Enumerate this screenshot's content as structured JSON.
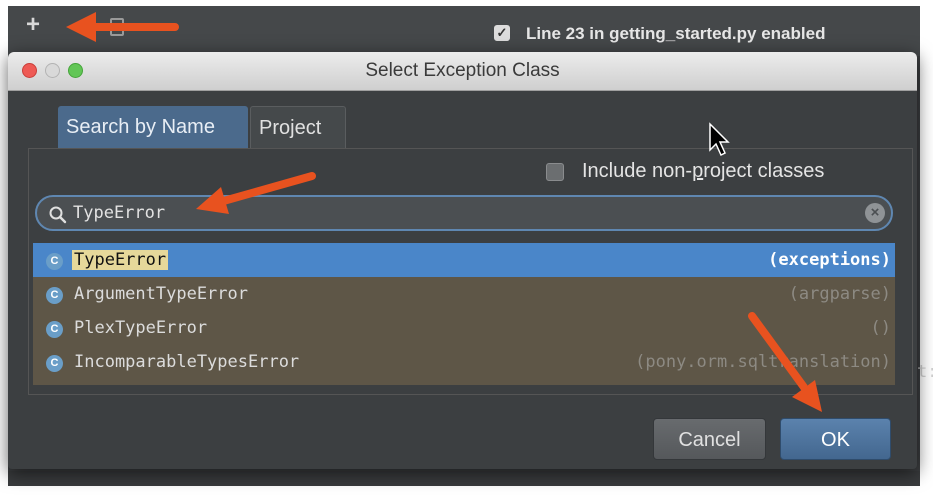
{
  "background": {
    "breakpoint_label": "Line 23 in getting_started.py enabled",
    "breakpoint_checkbox_checked": true,
    "code_fragment": "t:"
  },
  "dialog": {
    "title": "Select Exception Class",
    "tabs": [
      {
        "label": "Search by Name",
        "active": true
      },
      {
        "label": "Project",
        "active": false
      }
    ],
    "include_label": "Include non-project classes",
    "include_checked": false,
    "search": {
      "value": "TypeError",
      "icon": "search-icon"
    },
    "results": [
      {
        "icon": "C",
        "name": "TypeError",
        "package": "(exceptions)",
        "selected": true
      },
      {
        "icon": "C",
        "name": "ArgumentTypeError",
        "package": "(argparse)",
        "selected": false
      },
      {
        "icon": "C",
        "name": "PlexTypeError",
        "package": "()",
        "selected": false
      },
      {
        "icon": "C",
        "name": "IncomparableTypesError",
        "package": "(pony.orm.sqltranslation)",
        "selected": false
      }
    ],
    "buttons": {
      "cancel": "Cancel",
      "ok": "OK"
    }
  },
  "colors": {
    "annotation_arrow": "#e8521f",
    "selection": "#4a86c9",
    "highlight": "#e6d89a"
  }
}
